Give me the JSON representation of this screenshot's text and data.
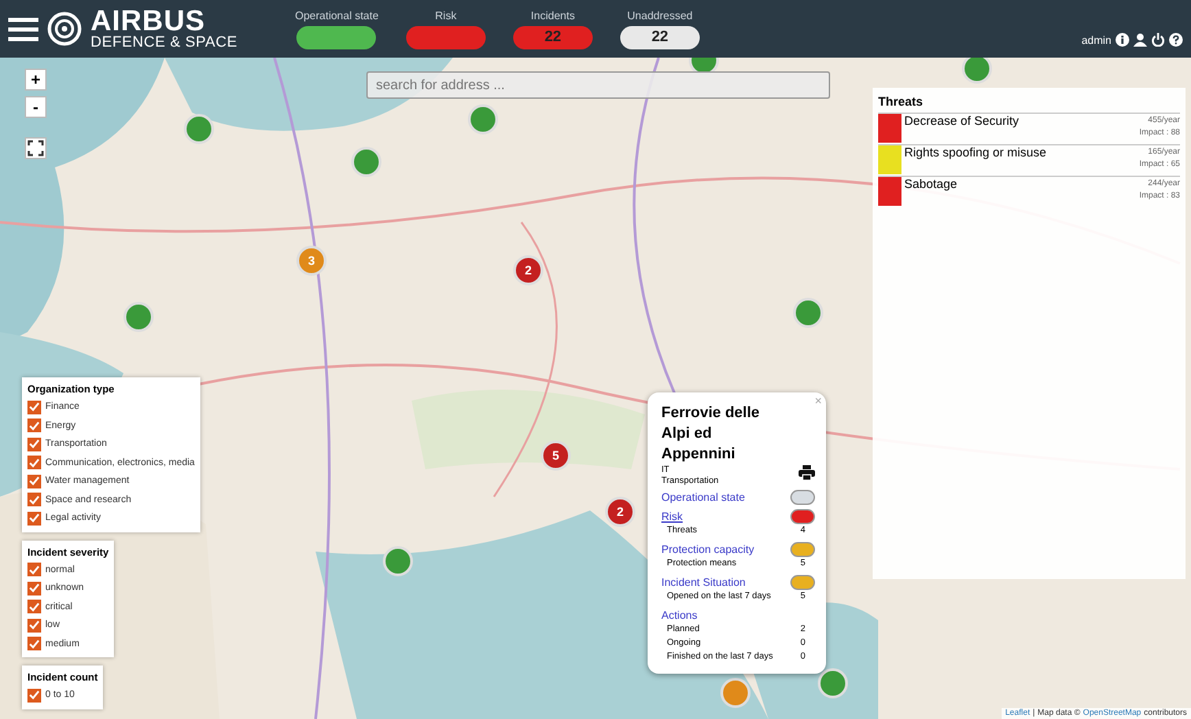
{
  "header": {
    "logo_name": "AIRBUS",
    "logo_sub": "DEFENCE & SPACE",
    "indicators": [
      {
        "label": "Operational state",
        "color": "#4fb84f"
      },
      {
        "label": "Risk",
        "color": "#e02020"
      },
      {
        "label": "Incidents",
        "color": "#e02020",
        "value": "22"
      },
      {
        "label": "Unaddressed",
        "color": "#e8e8e8",
        "value": "22"
      }
    ],
    "user": "admin"
  },
  "search": {
    "placeholder": "search for address ..."
  },
  "map_controls": [
    "+",
    "-"
  ],
  "markers": [
    {
      "color": "#3a9a3a"
    },
    {
      "color": "#3a9a3a"
    },
    {
      "color": "#3a9a3a"
    },
    {
      "color": "#3a9a3a"
    },
    {
      "color": "#3a9a3a"
    },
    {
      "color": "#e08a1a",
      "count": "3"
    },
    {
      "color": "#c42020",
      "count": "2"
    },
    {
      "color": "#3a9a3a"
    },
    {
      "color": "#3a9a3a"
    },
    {
      "color": "#c42020",
      "count": "5"
    },
    {
      "color": "#c42020",
      "count": "2"
    },
    {
      "color": "#3a9a3a"
    },
    {
      "color": "#e08a1a"
    },
    {
      "color": "#3a9a3a"
    }
  ],
  "threats": {
    "title": "Threats",
    "items": [
      {
        "name": "Decrease of Security",
        "rate": "455/year",
        "impact": "Impact : 88",
        "color": "#e02020"
      },
      {
        "name": "Rights spoofing or misuse",
        "rate": "165/year",
        "impact": "Impact : 65",
        "color": "#e8e020"
      },
      {
        "name": "Sabotage",
        "rate": "244/year",
        "impact": "Impact : 83",
        "color": "#e02020"
      }
    ]
  },
  "popup": {
    "close": "×",
    "title": "Ferrovie delle Alpi ed Appennini",
    "tags": [
      "IT",
      "Transportation"
    ],
    "sections": [
      {
        "label": "Operational state",
        "color": "#d8dde2"
      },
      {
        "label": "Risk",
        "color": "#e02020",
        "underline": true,
        "rows": [
          {
            "label": "Threats",
            "value": "4"
          }
        ]
      },
      {
        "label": "Protection capacity",
        "color": "#e8b020",
        "rows": [
          {
            "label": "Protection means",
            "value": "5"
          }
        ]
      },
      {
        "label": "Incident Situation",
        "color": "#e8b020",
        "rows": [
          {
            "label": "Opened on the last 7 days",
            "value": "5"
          }
        ]
      },
      {
        "label": "Actions",
        "rows": [
          {
            "label": "Planned",
            "value": "2"
          },
          {
            "label": "Ongoing",
            "value": "0"
          },
          {
            "label": "Finished on the last 7 days",
            "value": "0"
          }
        ]
      }
    ]
  },
  "filters": [
    {
      "title": "Organization type",
      "items": [
        {
          "label": "Finance",
          "checked": true
        },
        {
          "label": "Energy",
          "checked": true
        },
        {
          "label": "Transportation",
          "checked": true
        },
        {
          "label": "Communication, electronics, media",
          "checked": true
        },
        {
          "label": "Water management",
          "checked": true
        },
        {
          "label": "Space and research",
          "checked": true
        },
        {
          "label": "Legal activity",
          "checked": true
        }
      ]
    },
    {
      "title": "Incident severity",
      "items": [
        {
          "label": "normal",
          "checked": true
        },
        {
          "label": "unknown",
          "checked": true
        },
        {
          "label": "critical",
          "checked": true
        },
        {
          "label": "low",
          "checked": true
        },
        {
          "label": "medium",
          "checked": true
        }
      ]
    },
    {
      "title": "Incident count",
      "items": [
        {
          "label": "0 to 10",
          "checked": true
        }
      ]
    }
  ],
  "attribution": {
    "link": "Leaflet",
    "sep": "|",
    "text": "Map data ©",
    "osm": "OpenStreetMap",
    "tail": "contributors"
  }
}
